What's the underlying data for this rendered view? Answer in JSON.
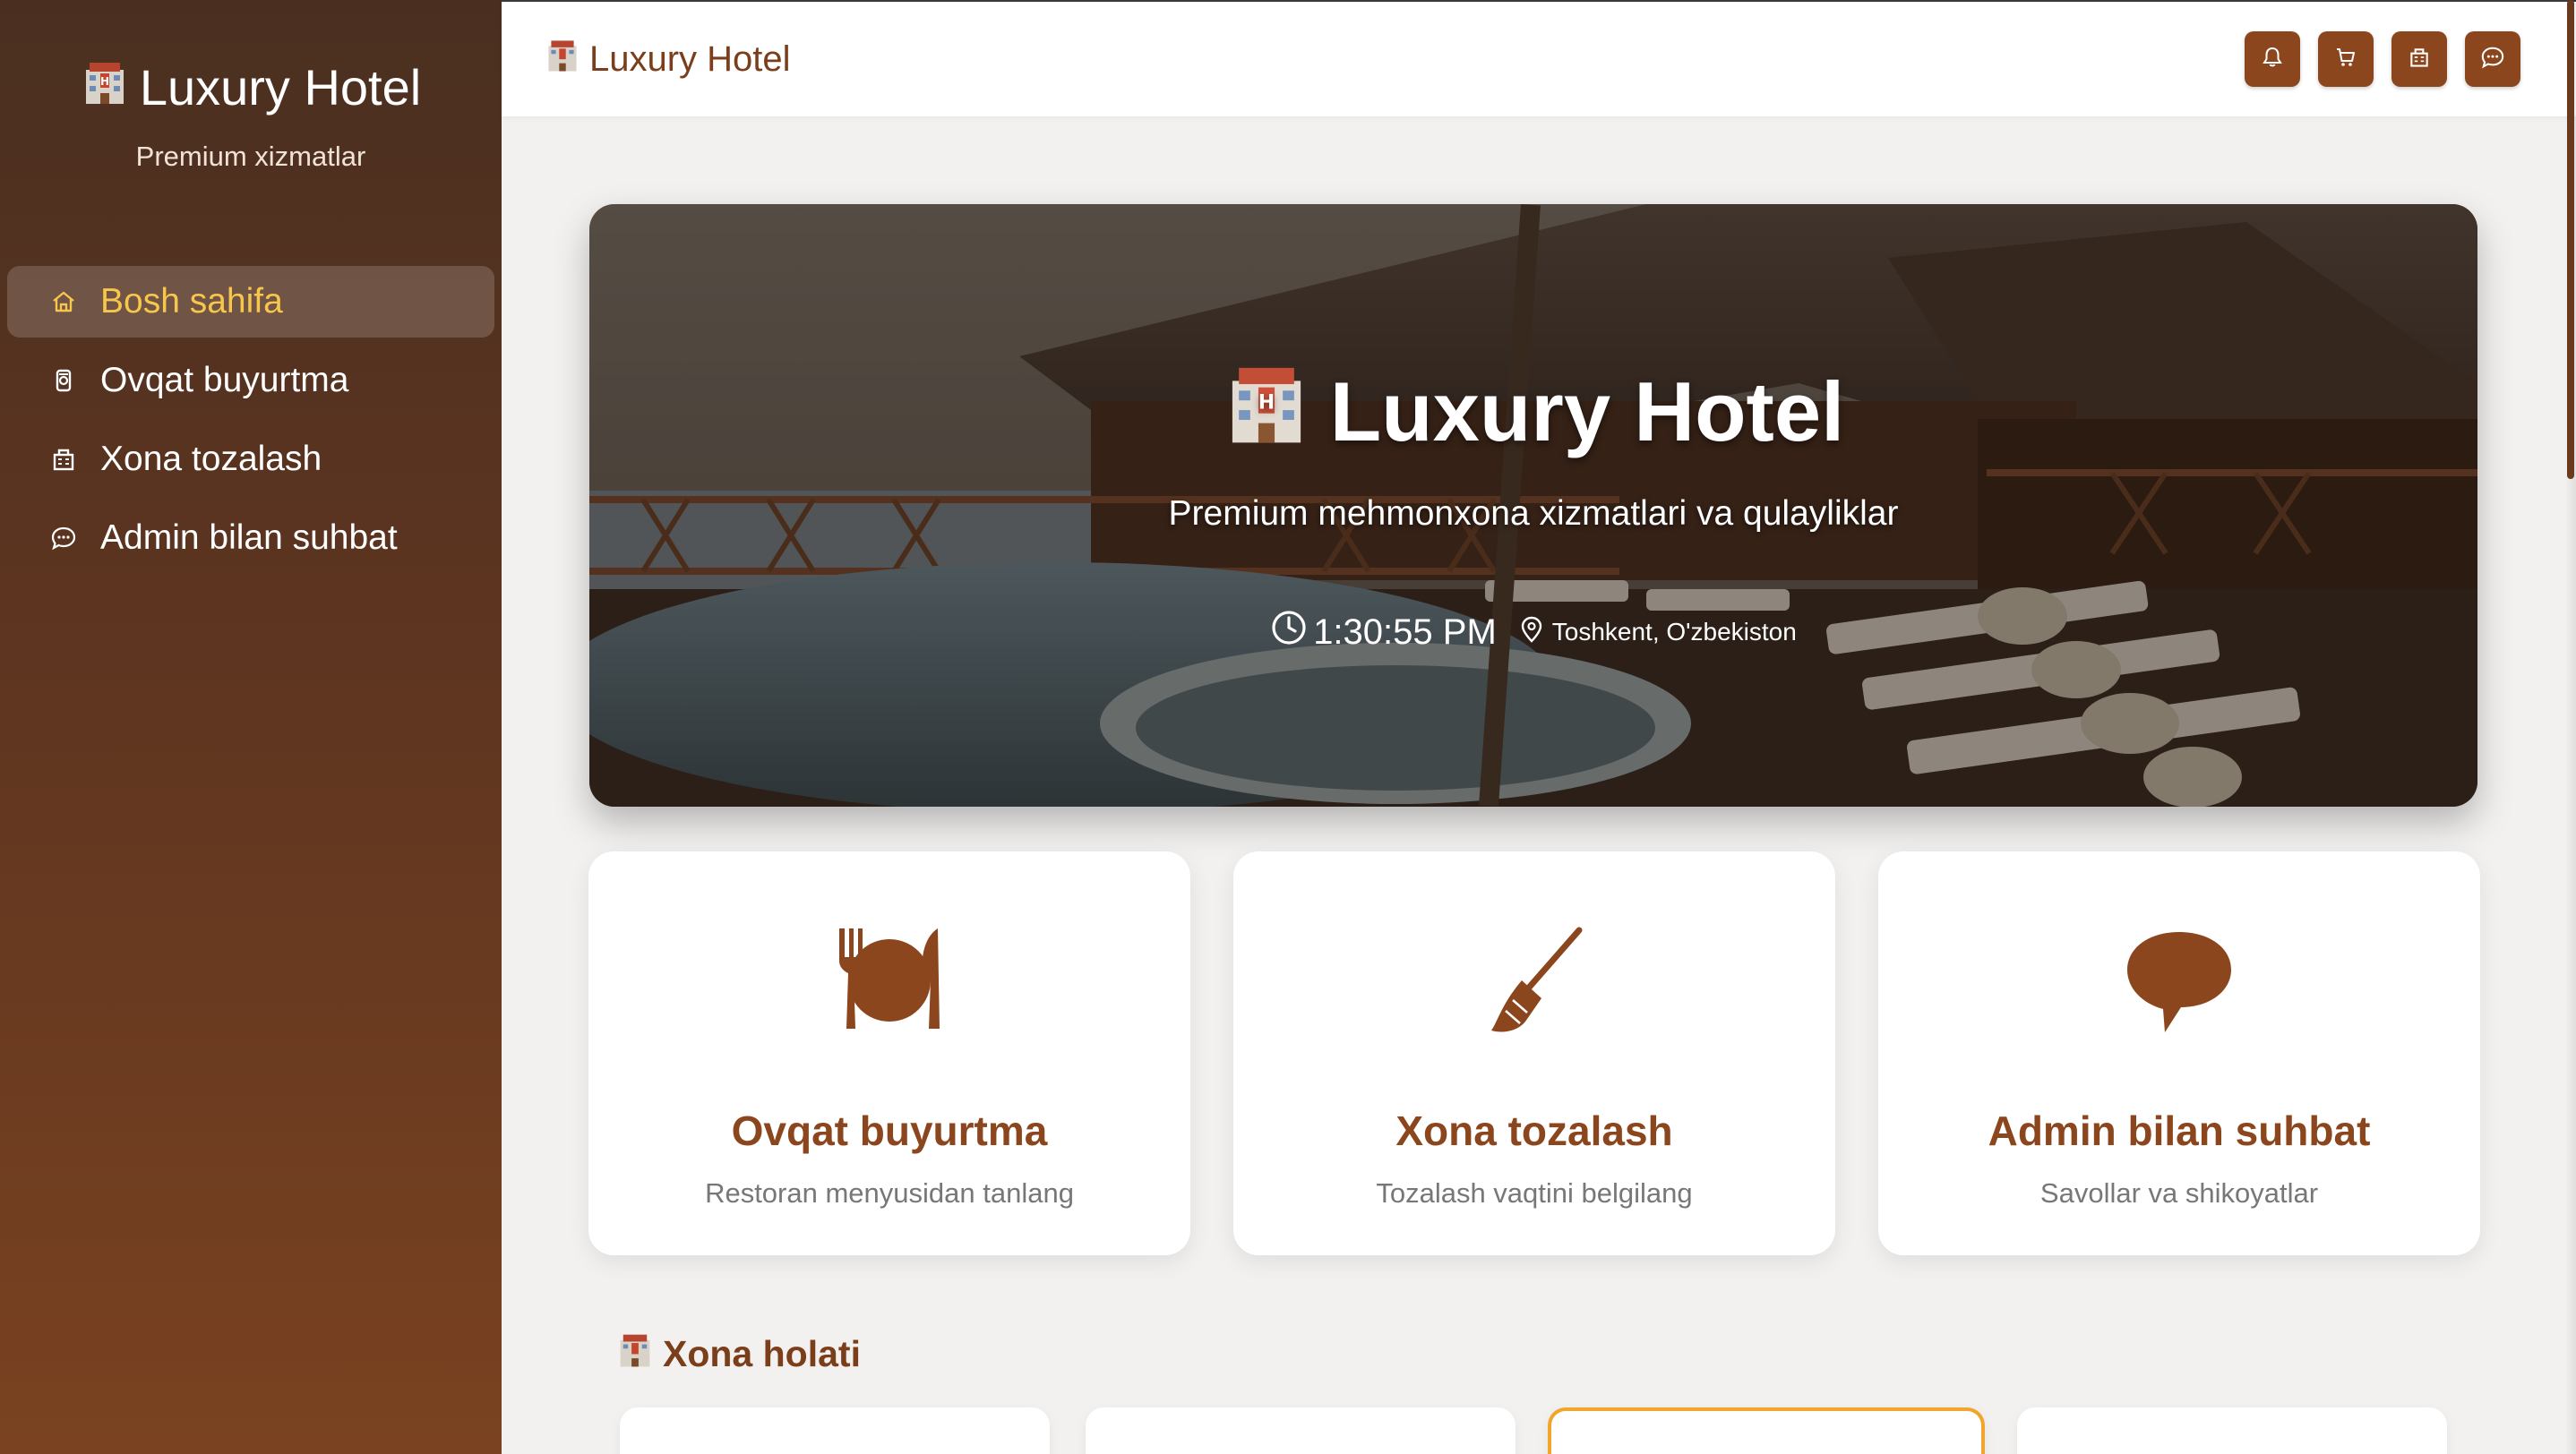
{
  "sidebar": {
    "brand_title": "Luxury Hotel",
    "brand_subtitle": "Premium xizmatlar",
    "items": [
      {
        "label": "Bosh sahifa",
        "icon": "home-icon",
        "active": true
      },
      {
        "label": "Ovqat buyurtma",
        "icon": "utensils-icon",
        "active": false
      },
      {
        "label": "Xona tozalash",
        "icon": "building-icon",
        "active": false
      },
      {
        "label": "Admin bilan suhbat",
        "icon": "chat-icon",
        "active": false
      }
    ]
  },
  "header": {
    "title": "Luxury Hotel",
    "actions": [
      {
        "icon": "bell-icon"
      },
      {
        "icon": "cart-icon"
      },
      {
        "icon": "building-icon"
      },
      {
        "icon": "chat-icon"
      }
    ]
  },
  "hero": {
    "title": "Luxury Hotel",
    "subtitle": "Premium mehmonxona xizmatlari va qulayliklar",
    "time": "1:30:55 PM",
    "location": "Toshkent, O'zbekiston"
  },
  "services": [
    {
      "title": "Ovqat buyurtma",
      "description": "Restoran menyusidan tanlang",
      "icon": "fork-plate-knife-icon"
    },
    {
      "title": "Xona tozalash",
      "description": "Tozalash vaqtini belgilang",
      "icon": "broom-icon"
    },
    {
      "title": "Admin bilan suhbat",
      "description": "Savollar va shikoyatlar",
      "icon": "speech-bubble-icon"
    }
  ],
  "rooms_section": {
    "title": "Xona holati"
  },
  "colors": {
    "brand": "#8c461e",
    "accent": "#f7c64a",
    "sidebar_top": "#4a2f20",
    "sidebar_bottom": "#7a4220"
  }
}
